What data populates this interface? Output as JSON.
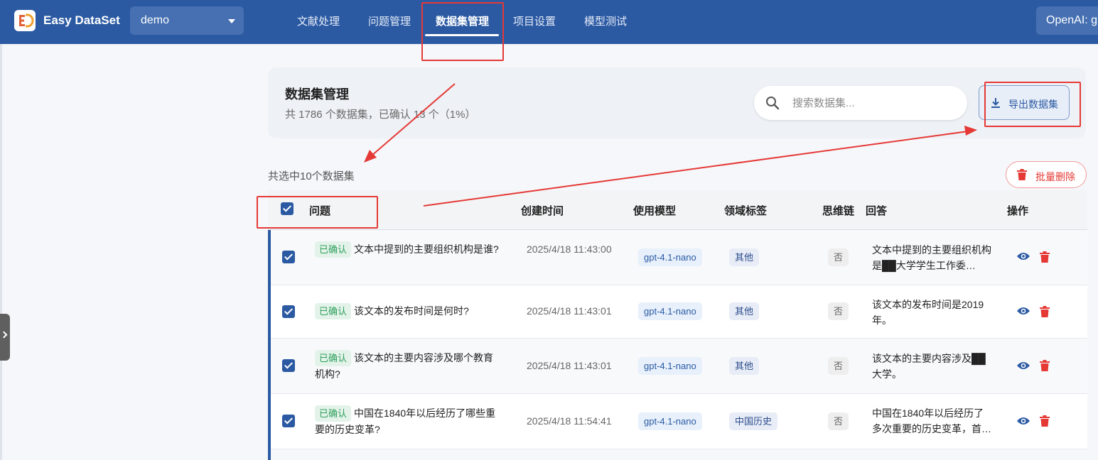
{
  "app": {
    "brand": "Easy DataSet",
    "project": "demo",
    "model_button": "OpenAI: g"
  },
  "nav": {
    "tabs": [
      {
        "label": "文献处理"
      },
      {
        "label": "问题管理"
      },
      {
        "label": "数据集管理"
      },
      {
        "label": "项目设置"
      },
      {
        "label": "模型测试"
      }
    ],
    "active": "数据集管理"
  },
  "header": {
    "title": "数据集管理",
    "subtitle": "共 1786 个数据集，已确认 13 个（1%）",
    "search_placeholder": "搜索数据集...",
    "export_label": "导出数据集"
  },
  "toolbar": {
    "selected_text": "共选中10个数据集",
    "bulk_delete_label": "批量删除"
  },
  "table": {
    "headers": {
      "question": "问题",
      "created": "创建时间",
      "model": "使用模型",
      "domain": "领域标签",
      "cot": "思维链",
      "answer": "回答",
      "actions": "操作"
    },
    "rows": [
      {
        "status": "已确认",
        "question": "文本中提到的主要组织机构是谁?",
        "created": "2025/4/18 11:43:00",
        "model": "gpt-4.1-nano",
        "domain": "其他",
        "cot": "否",
        "answer": "文本中提到的主要组织机构是██大学学生工作委…"
      },
      {
        "status": "已确认",
        "question": "该文本的发布时间是何时?",
        "created": "2025/4/18 11:43:01",
        "model": "gpt-4.1-nano",
        "domain": "其他",
        "cot": "否",
        "answer": "该文本的发布时间是2019年。"
      },
      {
        "status": "已确认",
        "question": "该文本的主要内容涉及哪个教育机构?",
        "created": "2025/4/18 11:43:01",
        "model": "gpt-4.1-nano",
        "domain": "其他",
        "cot": "否",
        "answer": "该文本的主要内容涉及██大学。"
      },
      {
        "status": "已确认",
        "question": "中国在1840年以后经历了哪些重要的历史变革?",
        "created": "2025/4/18 11:54:41",
        "model": "gpt-4.1-nano",
        "domain": "中国历史",
        "cot": "否",
        "answer": "中国在1840年以后经历了多次重要的历史变革，首…"
      }
    ]
  },
  "colors": {
    "primary": "#2b5aa3",
    "confirmed": "#2e9f5a",
    "danger": "#e53935",
    "annotation": "#e53935"
  }
}
